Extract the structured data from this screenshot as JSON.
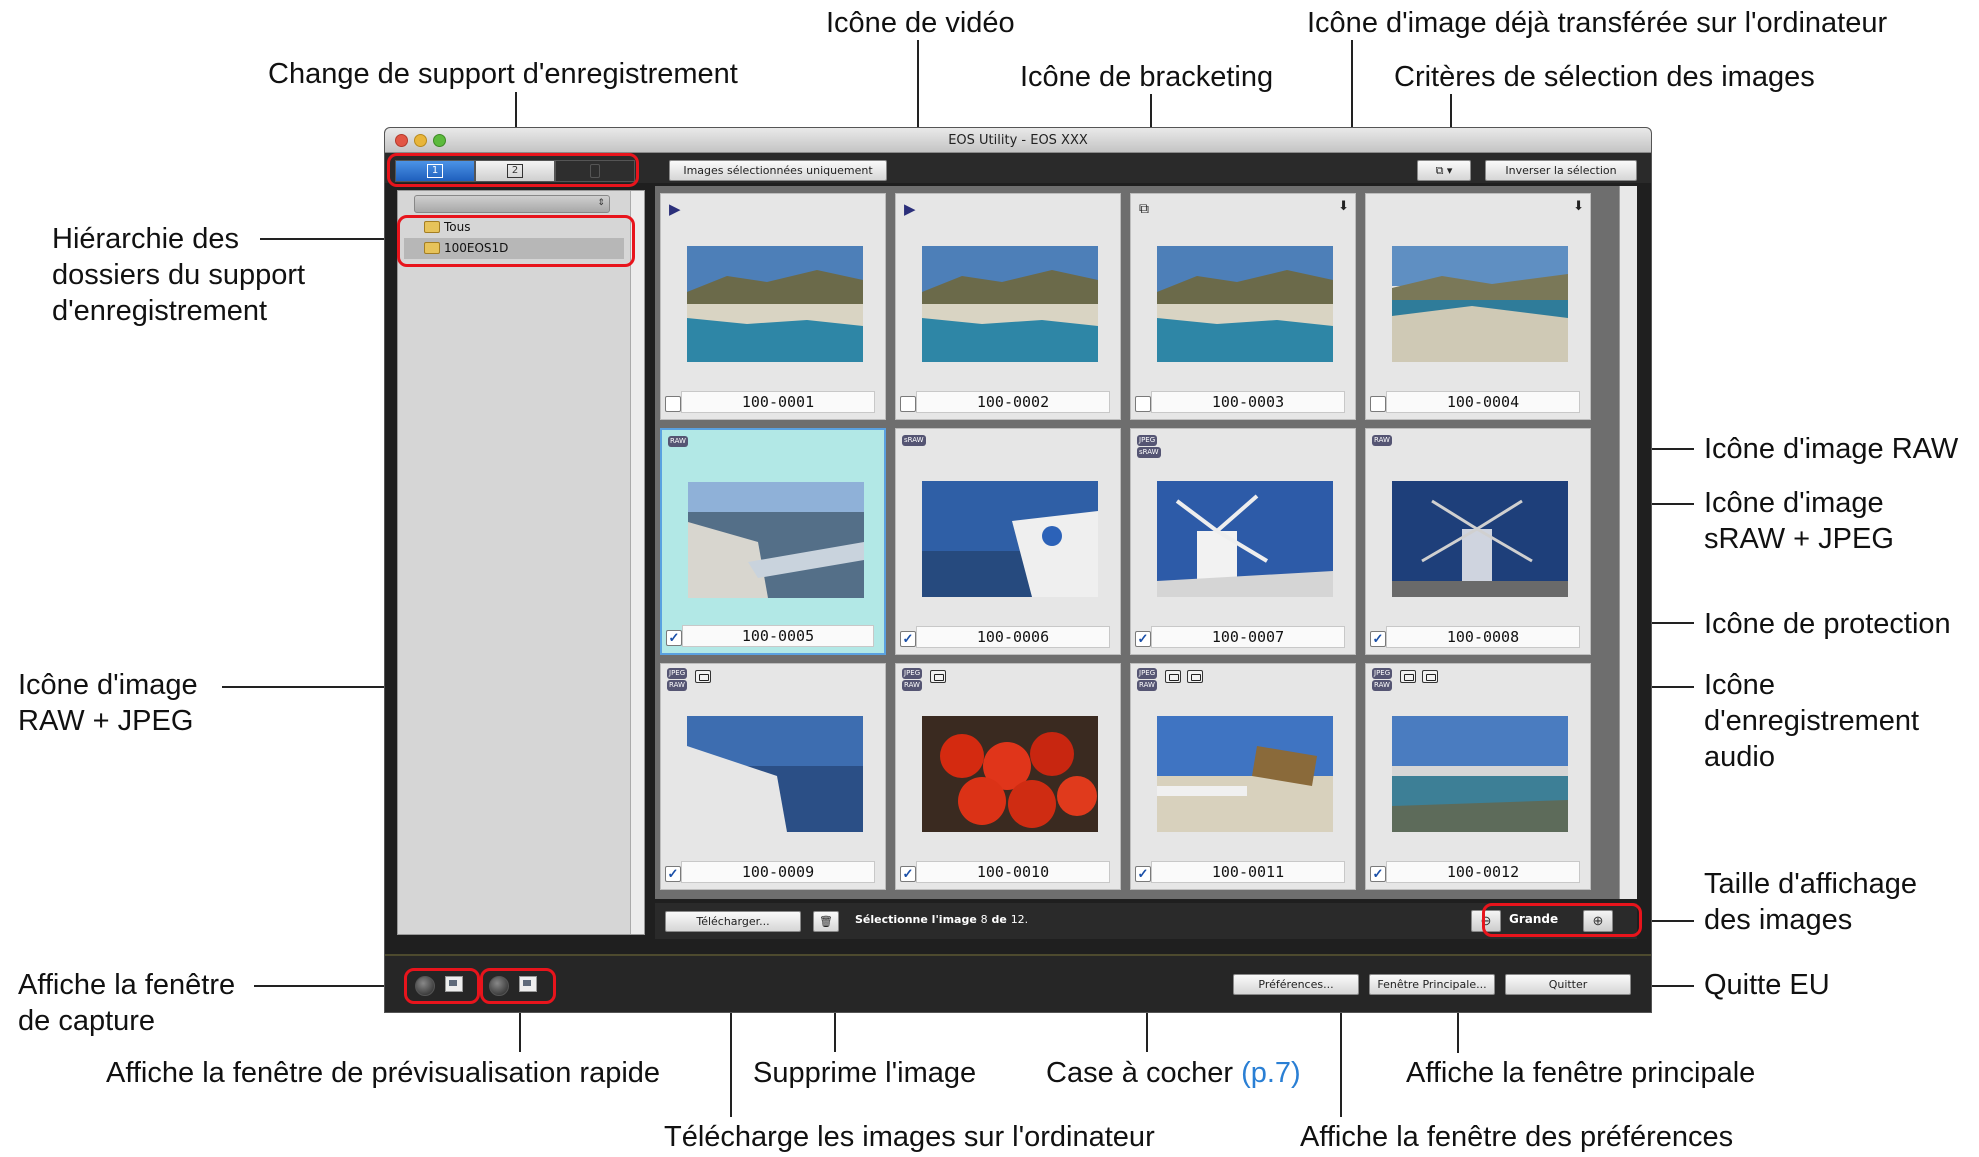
{
  "window": {
    "title": "EOS Utility - EOS XXX"
  },
  "toolbar": {
    "selected_only_label": "Images sélectionnées uniquement",
    "invert_selection_label": "Inverser la sélection",
    "selection_criteria_icon": "filter-dropdown-icon"
  },
  "media_switch": {
    "tabs": [
      {
        "label": "1",
        "state": "active"
      },
      {
        "label": "2",
        "state": "inactive"
      },
      {
        "label": "",
        "state": "dim"
      }
    ]
  },
  "sidebar": {
    "folders": [
      {
        "label": "Tous"
      },
      {
        "label": "100EOS1D"
      }
    ]
  },
  "thumbnails": [
    {
      "name": "100-0001",
      "checked": false,
      "icons": [
        "video-icon"
      ]
    },
    {
      "name": "100-0002",
      "checked": false,
      "icons": [
        "video-icon"
      ]
    },
    {
      "name": "100-0003",
      "checked": false,
      "icons": [
        "bracketing-icon",
        "transferred-icon"
      ]
    },
    {
      "name": "100-0004",
      "checked": false,
      "icons": [
        "transferred-icon"
      ]
    },
    {
      "name": "100-0005",
      "checked": true,
      "icons": [
        "raw-badge"
      ]
    },
    {
      "name": "100-0006",
      "checked": true,
      "icons": [
        "sraw-badge"
      ]
    },
    {
      "name": "100-0007",
      "checked": true,
      "icons": [
        "jpeg-badge",
        "sraw-badge"
      ]
    },
    {
      "name": "100-0008",
      "checked": true,
      "icons": [
        "raw-badge"
      ]
    },
    {
      "name": "100-0009",
      "checked": true,
      "icons": [
        "jpeg-badge",
        "raw-badge",
        "protect-icon"
      ]
    },
    {
      "name": "100-0010",
      "checked": true,
      "icons": [
        "jpeg-badge",
        "raw-badge",
        "protect-icon"
      ]
    },
    {
      "name": "100-0011",
      "checked": true,
      "icons": [
        "jpeg-badge",
        "raw-badge",
        "protect-icon",
        "audio-icon"
      ]
    },
    {
      "name": "100-0012",
      "checked": true,
      "icons": [
        "jpeg-badge",
        "raw-badge",
        "protect-icon",
        "audio-icon"
      ]
    }
  ],
  "badges": {
    "raw": "RAW",
    "sraw": "sRAW",
    "jpeg": "JPEG"
  },
  "bottombar": {
    "download_label": "Télécharger...",
    "selection_text": "Sélectionne l'image",
    "selected_count": "8",
    "selection_sep": "de",
    "total_count": "12.",
    "zoom_label": "Grande"
  },
  "footer": {
    "preferences_label": "Préférences...",
    "main_window_label": "Fenêtre Principale...",
    "quit_label": "Quitter"
  },
  "callouts": {
    "video_icon": "Icône de vidéo",
    "transferred_icon": "Icône d'image déjà transférée sur l'ordinateur",
    "change_media": "Change de support d'enregistrement",
    "bracketing_icon": "Icône de bracketing",
    "selection_criteria": "Critères de sélection des images",
    "folder_hierarchy_1": "Hiérarchie des",
    "folder_hierarchy_2": "dossiers du support",
    "folder_hierarchy_3": "d'enregistrement",
    "raw_icon": "Icône d'image RAW",
    "sraw_jpeg_1": "Icône d'image",
    "sraw_jpeg_2": "sRAW + JPEG",
    "protect_icon": "Icône de protection",
    "raw_jpeg_1": "Icône d'image",
    "raw_jpeg_2": "RAW + JPEG",
    "audio_1": "Icône",
    "audio_2": "d'enregistrement",
    "audio_3": "audio",
    "display_size_1": "Taille d'affichage",
    "display_size_2": "des images",
    "capture_1": "Affiche la fenêtre",
    "capture_2": "de capture",
    "quit": "Quitte EU",
    "quick_preview": "Affiche la fenêtre de prévisualisation rapide",
    "delete_image": "Supprime l'image",
    "checkbox": "Case à cocher",
    "checkbox_ref": "(p.7)",
    "main_window": "Affiche la fenêtre principale",
    "download": "Télécharge les images sur l'ordinateur",
    "preferences": "Affiche la fenêtre des préférences"
  },
  "colors": {
    "highlight_red": "#e8141c",
    "link_blue": "#2a7fd4",
    "selected_thumb": "#b2e8e6"
  }
}
